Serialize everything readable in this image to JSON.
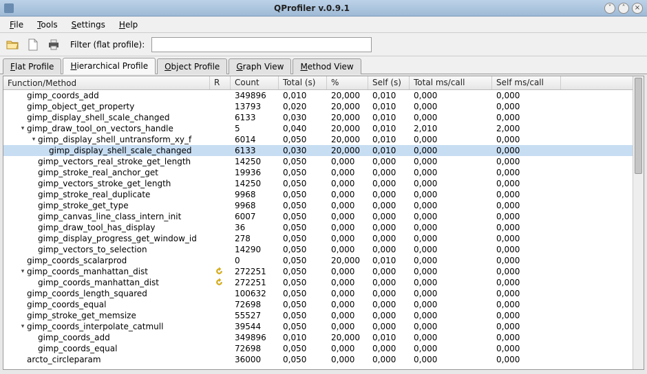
{
  "window": {
    "title": "QProfiler v.0.9.1"
  },
  "menubar": [
    {
      "label": "File",
      "u": "F"
    },
    {
      "label": "Tools",
      "u": "T"
    },
    {
      "label": "Settings",
      "u": "S"
    },
    {
      "label": "Help",
      "u": "H"
    }
  ],
  "toolbar": {
    "filter_label": "Filter (flat profile):",
    "filter_value": ""
  },
  "tabs": [
    {
      "label": "Flat Profile",
      "u": "F",
      "active": false
    },
    {
      "label": "Hierarchical Profile",
      "u": "H",
      "active": true
    },
    {
      "label": "Object Profile",
      "u": "O",
      "active": false
    },
    {
      "label": "Graph View",
      "u": "G",
      "active": false
    },
    {
      "label": "Method View",
      "u": "M",
      "active": false
    }
  ],
  "columns": [
    {
      "key": "fn",
      "label": "Function/Method",
      "cls": "col-fn"
    },
    {
      "key": "r",
      "label": "R",
      "cls": "col-r"
    },
    {
      "key": "count",
      "label": "Count",
      "cls": "col-count"
    },
    {
      "key": "total",
      "label": "Total (s)",
      "cls": "col-total"
    },
    {
      "key": "pct",
      "label": "%",
      "cls": "col-pct"
    },
    {
      "key": "self",
      "label": "Self (s)",
      "cls": "col-self"
    },
    {
      "key": "tmsc",
      "label": "Total ms/call",
      "cls": "col-tmsc"
    },
    {
      "key": "smsc",
      "label": "Self ms/call",
      "cls": "col-smsc"
    }
  ],
  "rows": [
    {
      "depth": 1,
      "exp": "",
      "fn": "gimp_coords_add",
      "count": "349896",
      "total": "0,010",
      "pct": "20,000",
      "self": "0,010",
      "tmsc": "0,000",
      "smsc": "0,000"
    },
    {
      "depth": 1,
      "exp": "",
      "fn": "gimp_object_get_property",
      "count": "13793",
      "total": "0,020",
      "pct": "20,000",
      "self": "0,010",
      "tmsc": "0,000",
      "smsc": "0,000"
    },
    {
      "depth": 1,
      "exp": "",
      "fn": "gimp_display_shell_scale_changed",
      "count": "6133",
      "total": "0,030",
      "pct": "20,000",
      "self": "0,010",
      "tmsc": "0,000",
      "smsc": "0,000"
    },
    {
      "depth": 1,
      "exp": "v",
      "fn": "gimp_draw_tool_on_vectors_handle",
      "count": "5",
      "total": "0,040",
      "pct": "20,000",
      "self": "0,010",
      "tmsc": "2,010",
      "smsc": "2,000"
    },
    {
      "depth": 2,
      "exp": "v",
      "fn": "gimp_display_shell_untransform_xy_f",
      "count": "6014",
      "total": "0,050",
      "pct": "20,000",
      "self": "0,010",
      "tmsc": "0,000",
      "smsc": "0,000"
    },
    {
      "depth": 3,
      "exp": "",
      "fn": "gimp_display_shell_scale_changed",
      "count": "6133",
      "total": "0,030",
      "pct": "20,000",
      "self": "0,010",
      "tmsc": "0,000",
      "smsc": "0,000",
      "selected": true
    },
    {
      "depth": 2,
      "exp": "",
      "fn": "gimp_vectors_real_stroke_get_length",
      "count": "14250",
      "total": "0,050",
      "pct": "0,000",
      "self": "0,000",
      "tmsc": "0,000",
      "smsc": "0,000"
    },
    {
      "depth": 2,
      "exp": "",
      "fn": "gimp_stroke_real_anchor_get",
      "count": "19936",
      "total": "0,050",
      "pct": "0,000",
      "self": "0,000",
      "tmsc": "0,000",
      "smsc": "0,000"
    },
    {
      "depth": 2,
      "exp": "",
      "fn": "gimp_vectors_stroke_get_length",
      "count": "14250",
      "total": "0,050",
      "pct": "0,000",
      "self": "0,000",
      "tmsc": "0,000",
      "smsc": "0,000"
    },
    {
      "depth": 2,
      "exp": "",
      "fn": "gimp_stroke_real_duplicate",
      "count": "9968",
      "total": "0,050",
      "pct": "0,000",
      "self": "0,000",
      "tmsc": "0,000",
      "smsc": "0,000"
    },
    {
      "depth": 2,
      "exp": "",
      "fn": "gimp_stroke_get_type",
      "count": "9968",
      "total": "0,050",
      "pct": "0,000",
      "self": "0,000",
      "tmsc": "0,000",
      "smsc": "0,000"
    },
    {
      "depth": 2,
      "exp": "",
      "fn": "gimp_canvas_line_class_intern_init",
      "count": "6007",
      "total": "0,050",
      "pct": "0,000",
      "self": "0,000",
      "tmsc": "0,000",
      "smsc": "0,000"
    },
    {
      "depth": 2,
      "exp": "",
      "fn": "gimp_draw_tool_has_display",
      "count": "36",
      "total": "0,050",
      "pct": "0,000",
      "self": "0,000",
      "tmsc": "0,000",
      "smsc": "0,000"
    },
    {
      "depth": 2,
      "exp": "",
      "fn": "gimp_display_progress_get_window_id",
      "count": "278",
      "total": "0,050",
      "pct": "0,000",
      "self": "0,000",
      "tmsc": "0,000",
      "smsc": "0,000"
    },
    {
      "depth": 2,
      "exp": "",
      "fn": "gimp_vectors_to_selection",
      "count": "14290",
      "total": "0,050",
      "pct": "0,000",
      "self": "0,000",
      "tmsc": "0,000",
      "smsc": "0,000"
    },
    {
      "depth": 1,
      "exp": "",
      "fn": "gimp_coords_scalarprod",
      "count": "0",
      "total": "0,050",
      "pct": "20,000",
      "self": "0,010",
      "tmsc": "0,000",
      "smsc": "0,000"
    },
    {
      "depth": 1,
      "exp": "v",
      "fn": "gimp_coords_manhattan_dist",
      "r": true,
      "count": "272251",
      "total": "0,050",
      "pct": "0,000",
      "self": "0,000",
      "tmsc": "0,000",
      "smsc": "0,000"
    },
    {
      "depth": 2,
      "exp": "",
      "fn": "gimp_coords_manhattan_dist",
      "r": true,
      "count": "272251",
      "total": "0,050",
      "pct": "0,000",
      "self": "0,000",
      "tmsc": "0,000",
      "smsc": "0,000"
    },
    {
      "depth": 1,
      "exp": "",
      "fn": "gimp_coords_length_squared",
      "count": "100632",
      "total": "0,050",
      "pct": "0,000",
      "self": "0,000",
      "tmsc": "0,000",
      "smsc": "0,000"
    },
    {
      "depth": 1,
      "exp": "",
      "fn": "gimp_coords_equal",
      "count": "72698",
      "total": "0,050",
      "pct": "0,000",
      "self": "0,000",
      "tmsc": "0,000",
      "smsc": "0,000"
    },
    {
      "depth": 1,
      "exp": "",
      "fn": "gimp_stroke_get_memsize",
      "count": "55527",
      "total": "0,050",
      "pct": "0,000",
      "self": "0,000",
      "tmsc": "0,000",
      "smsc": "0,000"
    },
    {
      "depth": 1,
      "exp": "v",
      "fn": "gimp_coords_interpolate_catmull",
      "count": "39544",
      "total": "0,050",
      "pct": "0,000",
      "self": "0,000",
      "tmsc": "0,000",
      "smsc": "0,000"
    },
    {
      "depth": 2,
      "exp": "",
      "fn": "gimp_coords_add",
      "count": "349896",
      "total": "0,010",
      "pct": "20,000",
      "self": "0,010",
      "tmsc": "0,000",
      "smsc": "0,000"
    },
    {
      "depth": 2,
      "exp": "",
      "fn": "gimp_coords_equal",
      "count": "72698",
      "total": "0,050",
      "pct": "0,000",
      "self": "0,000",
      "tmsc": "0,000",
      "smsc": "0,000"
    },
    {
      "depth": 1,
      "exp": "",
      "fn": "arcto_circleparam",
      "count": "36000",
      "total": "0,050",
      "pct": "0,000",
      "self": "0,000",
      "tmsc": "0,000",
      "smsc": "0,000"
    }
  ]
}
